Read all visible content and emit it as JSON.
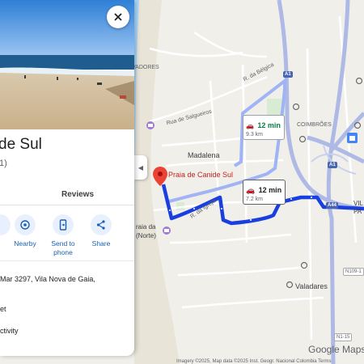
{
  "place": {
    "title": "de Sul",
    "subtitle": "1)",
    "tab_reviews": "Reviews",
    "actions": [
      {
        "label": "Nearby",
        "icon": "nearby-icon"
      },
      {
        "label": "Send to\nphone",
        "icon": "send-to-phone-icon"
      },
      {
        "label": "Share",
        "icon": "share-icon"
      }
    ],
    "address": "Mar 3297, Vila Nova de Gaia,",
    "info_line_2": "et",
    "info_line_3": "ctivity"
  },
  "map": {
    "pin_label": "Praia de Canide Sul",
    "route_primary": {
      "time": "12 min",
      "distance": "7.2 km"
    },
    "route_alternative": {
      "time": "12 min",
      "distance": "9.3 km"
    },
    "labels": {
      "salvadores": "VADORES",
      "r_belgica": "R. da Bélgica",
      "rua_salgueiros": "Rua de Salgueiros",
      "coimbroes": "COIMBRÕES",
      "madalena": "Madalena",
      "praia_da_norte_1": "raia da",
      "praia_da_norte_2": "(Norte)",
      "valadares": "Valadares",
      "vila": "VIL",
      "pa": "PA",
      "r_da_igreja": "R. da Igreja"
    },
    "shields": {
      "a1_top": "A1",
      "a1_mid": "A1",
      "a44": "A44",
      "n109": "N109-1",
      "n1_15": "N1-15"
    },
    "logo": "Google Maps",
    "attribution": "Imagery ©2025, Map data ©2025 Inst. Geogr. Nacional    Colombia    Terms",
    "colors": {
      "route": "#1a3fe0",
      "route_alt": "#9fb3f5",
      "pin": "#ea4335",
      "highway": "#c4cce8"
    }
  }
}
